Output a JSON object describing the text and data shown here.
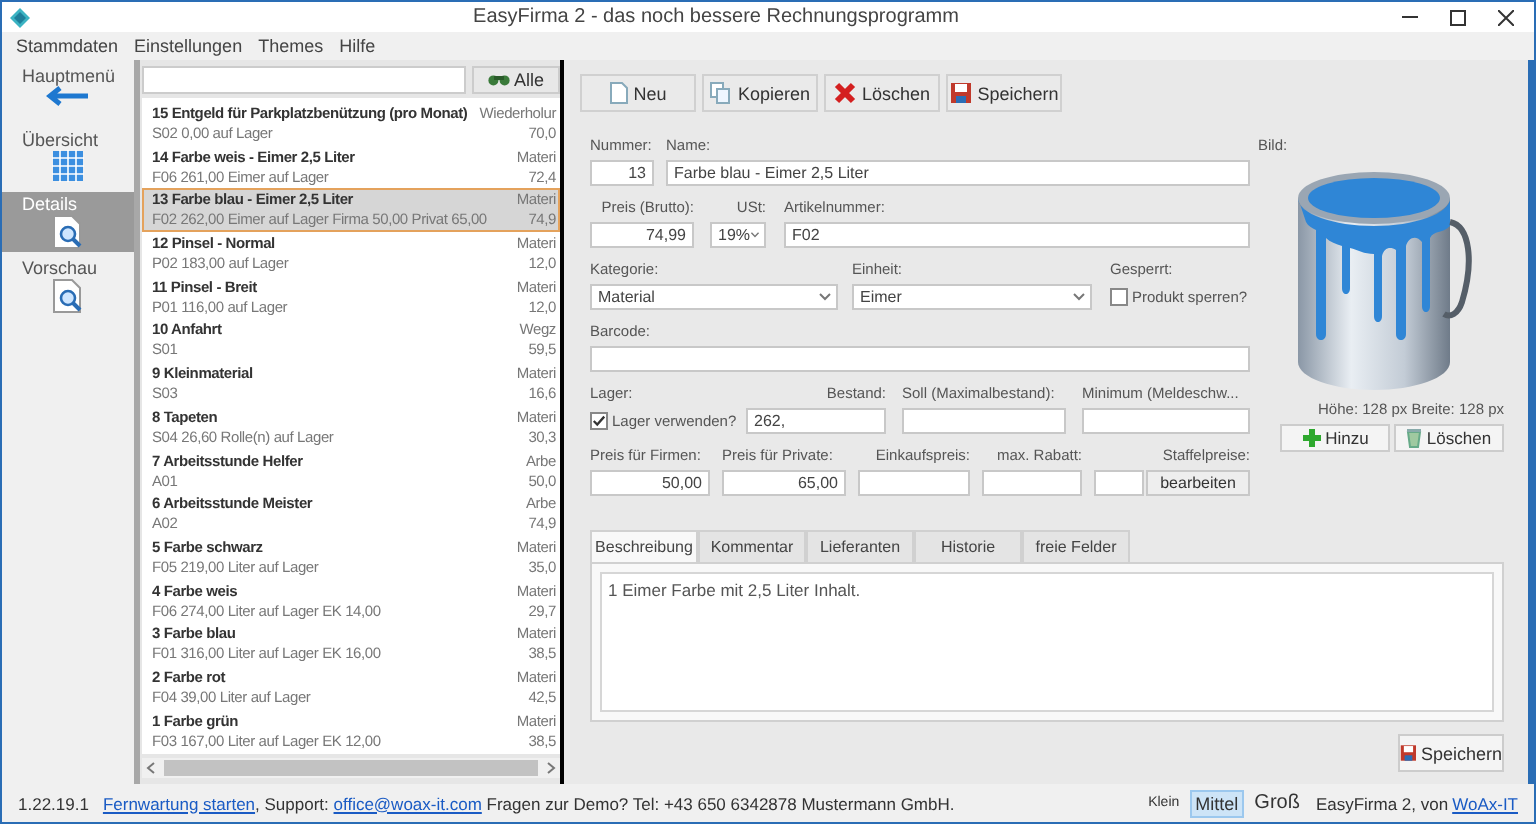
{
  "window": {
    "title": "EasyFirma 2 - das noch bessere Rechnungsprogramm"
  },
  "menu": [
    "Stammdaten",
    "Einstellungen",
    "Themes",
    "Hilfe"
  ],
  "nav": [
    {
      "label": "Hauptmenü",
      "kind": "back",
      "selected": false
    },
    {
      "label": "Übersicht",
      "kind": "grid",
      "selected": false
    },
    {
      "label": "Details",
      "kind": "details",
      "selected": true
    },
    {
      "label": "Vorschau",
      "kind": "preview",
      "selected": false
    }
  ],
  "filter_button": "Alle",
  "products": [
    {
      "title": "15 Entgeld für Parkplatzbenützung (pro Monat)",
      "subtitle": "S02 0,00 auf Lager",
      "column_2": "Wiederholur",
      "column_3": "70,0",
      "selected": false
    },
    {
      "title": "14 Farbe weis - Eimer 2,5 Liter",
      "subtitle": "F06 261,00 Eimer auf Lager",
      "column_2": "Materi",
      "column_3": "72,4",
      "selected": false
    },
    {
      "title": "13 Farbe blau - Eimer 2,5 Liter",
      "subtitle": "F02 262,00 Eimer auf Lager Firma 50,00 Privat 65,00",
      "column_2": "Materi",
      "column_3": "74,9",
      "selected": true
    },
    {
      "title": "12 Pinsel - Normal",
      "subtitle": "P02 183,00 auf Lager",
      "column_2": "Materi",
      "column_3": "12,0",
      "selected": false
    },
    {
      "title": "11 Pinsel - Breit",
      "subtitle": "P01 116,00 auf Lager",
      "column_2": "Materi",
      "column_3": "12,0",
      "selected": false
    },
    {
      "title": "10 Anfahrt",
      "subtitle": "S01",
      "column_2": "Wegz",
      "column_3": "59,5",
      "selected": false
    },
    {
      "title": "9 Kleinmaterial",
      "subtitle": "S03",
      "column_2": "Materi",
      "column_3": "16,6",
      "selected": false
    },
    {
      "title": "8 Tapeten",
      "subtitle": "S04 26,60 Rolle(n) auf Lager",
      "column_2": "Materi",
      "column_3": "30,3",
      "selected": false
    },
    {
      "title": "7 Arbeitsstunde Helfer",
      "subtitle": "A01",
      "column_2": "Arbe",
      "column_3": "50,0",
      "selected": false
    },
    {
      "title": "6 Arbeitsstunde Meister",
      "subtitle": "A02",
      "column_2": "Arbe",
      "column_3": "74,9",
      "selected": false
    },
    {
      "title": "5 Farbe schwarz",
      "subtitle": "F05 219,00 Liter auf Lager",
      "column_2": "Materi",
      "column_3": "35,0",
      "selected": false
    },
    {
      "title": "4 Farbe weis",
      "subtitle": "F06 274,00 Liter auf Lager EK 14,00",
      "column_2": "Materi",
      "column_3": "29,7",
      "selected": false
    },
    {
      "title": "3 Farbe blau",
      "subtitle": "F01 316,00 Liter auf Lager EK 16,00",
      "column_2": "Materi",
      "column_3": "38,5",
      "selected": false
    },
    {
      "title": "2 Farbe rot",
      "subtitle": "F04 39,00 Liter auf Lager",
      "column_2": "Materi",
      "column_3": "42,5",
      "selected": false
    },
    {
      "title": "1 Farbe grün",
      "subtitle": "F03 167,00 Liter auf Lager EK 12,00",
      "column_2": "Materi",
      "column_3": "38,5",
      "selected": false
    }
  ],
  "toolbar": [
    {
      "label": "Neu",
      "kind": "new"
    },
    {
      "label": "Kopieren",
      "kind": "copy"
    },
    {
      "label": "Löschen",
      "kind": "delete"
    },
    {
      "label": "Speichern",
      "kind": "save"
    }
  ],
  "form": {
    "nummer": {
      "label": "Nummer:",
      "value": "13"
    },
    "name": {
      "label": "Name:",
      "value": "Farbe blau - Eimer 2,5 Liter"
    },
    "preis": {
      "label": "Preis (Brutto):",
      "value": "74,99"
    },
    "ust": {
      "label": "USt:",
      "value": "19%"
    },
    "artikelnummer": {
      "label": "Artikelnummer:",
      "value": "F02"
    },
    "kategorie": {
      "label": "Kategorie:",
      "value": "Material"
    },
    "einheit": {
      "label": "Einheit:",
      "value": "Eimer"
    },
    "gesperrt": {
      "label": "Gesperrt:",
      "option": "Produkt sperren?",
      "checked": false
    },
    "barcode": {
      "label": "Barcode:"
    },
    "lager": {
      "label": "Lager:",
      "option": "Lager verwenden?",
      "checked": true
    },
    "bestand": {
      "label": "Bestand:",
      "value": "262,"
    },
    "soll": {
      "label": "Soll (Maximalbestand):"
    },
    "minimum": {
      "label": "Minimum (Meldeschw..."
    },
    "preis_firmen": {
      "label": "Preis für Firmen:",
      "value": "50,00"
    },
    "preis_private": {
      "label": "Preis für Private:",
      "value": "65,00"
    },
    "einkaufspreis": {
      "label": "Einkaufspreis:"
    },
    "rabatt": {
      "label": "max. Rabatt:"
    },
    "staffelpreise": {
      "label": "Staffelpreise:",
      "button": "bearbeiten"
    }
  },
  "image": {
    "label": "Bild:",
    "size": "Höhe: 128 px Breite: 128 px",
    "buttons": [
      {
        "label": "Hinzu",
        "kind": "add"
      },
      {
        "label": "Löschen",
        "kind": "delete"
      }
    ]
  },
  "tabs": [
    {
      "label": "Beschreibung",
      "selected": true
    },
    {
      "label": "Kommentar",
      "selected": false
    },
    {
      "label": "Lieferanten",
      "selected": false
    },
    {
      "label": "Historie",
      "selected": false
    },
    {
      "label": "freie Felder",
      "selected": false
    }
  ],
  "description": "1 Eimer Farbe mit 2,5 Liter Inhalt.",
  "save_button": "Speichern",
  "status_bar": {
    "version": "1.22.19.1",
    "remote_link": "Fernwartung starten",
    "support_label": ", Support:",
    "email_link": "office@woax-it.com",
    "info": "Fragen zur Demo? Tel: +43 650 6342878 Mustermann GmbH.",
    "sizes": [
      {
        "label": "Klein",
        "kind": "small",
        "selected": false
      },
      {
        "label": "Mittel",
        "kind": "medium",
        "selected": true
      },
      {
        "label": "Groß",
        "kind": "large",
        "selected": false
      }
    ],
    "credit": "EasyFirma 2, von",
    "credit_link": "WoAx-IT"
  }
}
